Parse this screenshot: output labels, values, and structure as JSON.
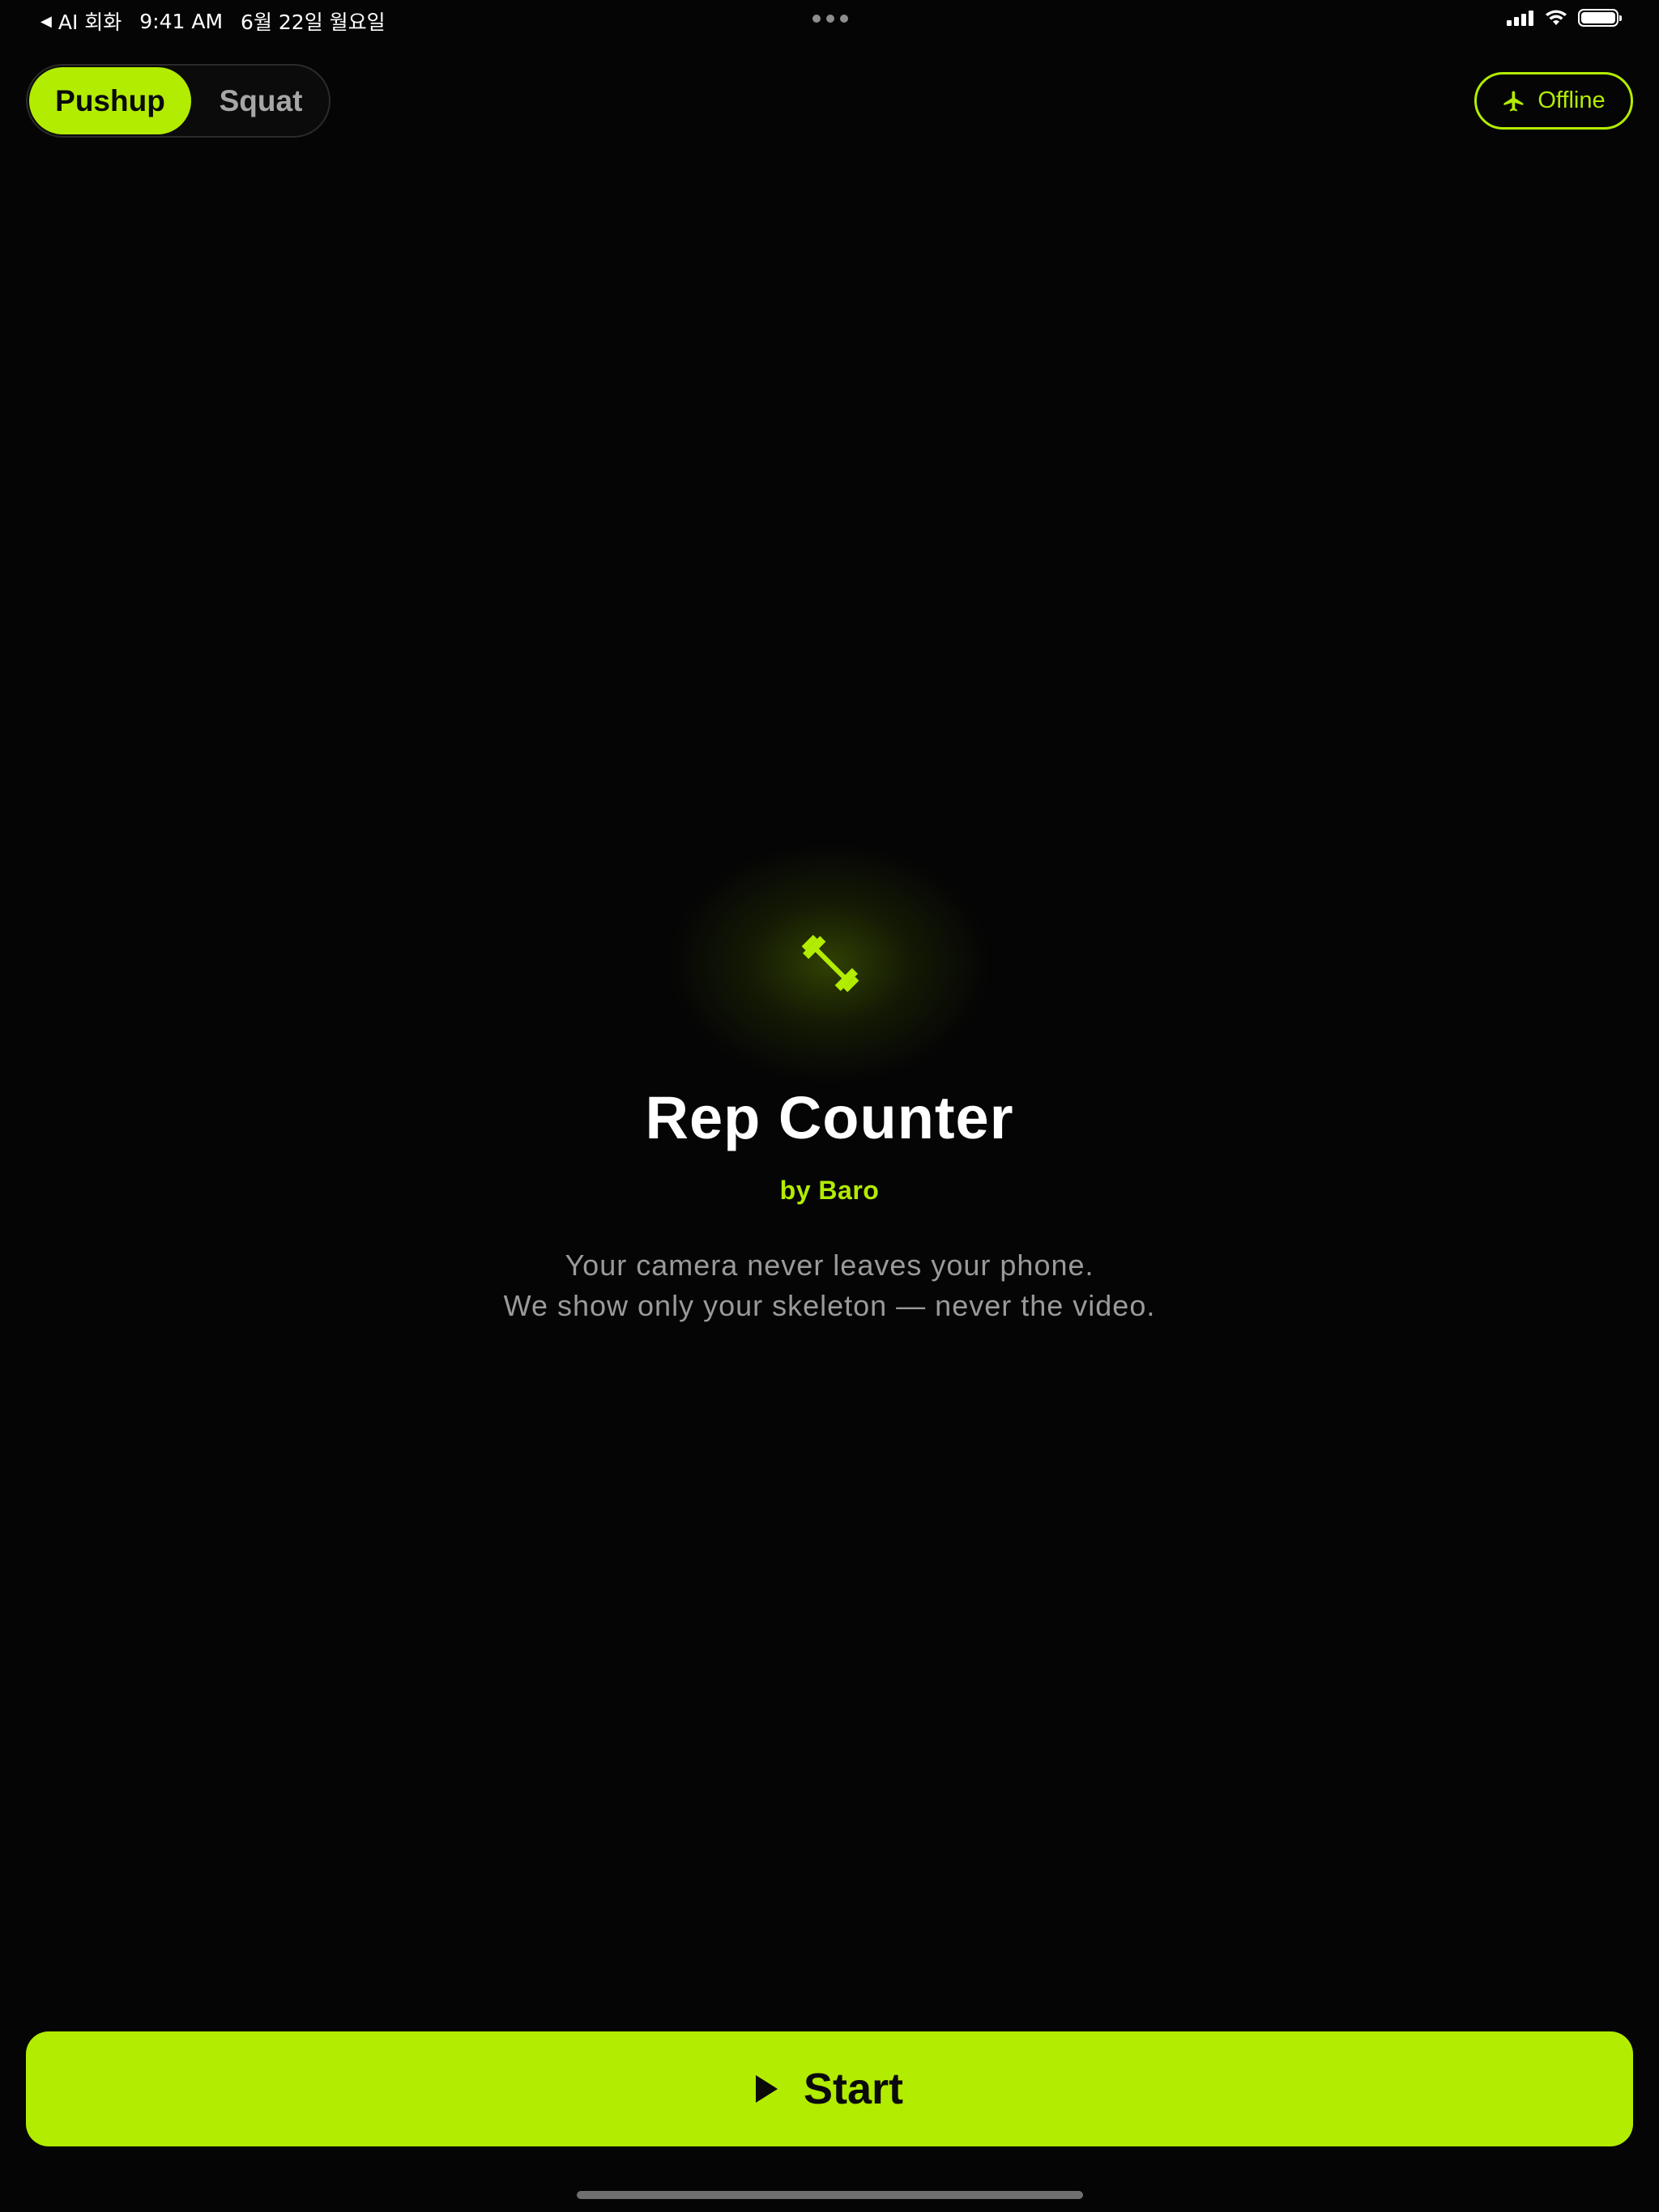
{
  "status_bar": {
    "back_label": "AI 회화",
    "time": "9:41 AM",
    "date": "6월 22일 월요일"
  },
  "mode_toggle": {
    "options": [
      "Pushup",
      "Squat"
    ],
    "selected": "Pushup"
  },
  "offline_badge": {
    "label": "Offline",
    "icon": "airplane-icon"
  },
  "hero": {
    "icon": "barbell-icon",
    "title": "Rep Counter",
    "byline": "by Baro",
    "tagline_line1": "Your camera never leaves your phone.",
    "tagline_line2": "We show only your skeleton — never the video."
  },
  "start_button": {
    "label": "Start",
    "icon": "play-icon"
  },
  "colors": {
    "accent": "#b2ec00",
    "background": "#050505",
    "text_primary": "#ffffff",
    "text_secondary": "#9a9a9a",
    "segment_inactive_text": "#a6a6a6"
  }
}
